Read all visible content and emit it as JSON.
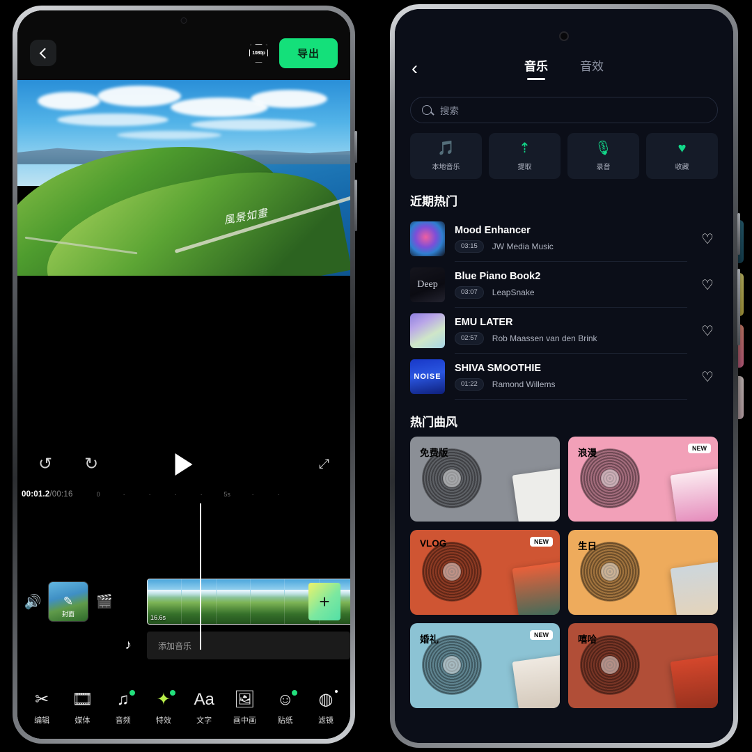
{
  "editor": {
    "back_icon": "chevron-left-icon",
    "quality_label": "1080p",
    "export_label": "导出",
    "preview_watermark": "風景如畫",
    "controls": {
      "undo": "↺",
      "redo": "↻",
      "play": "play-icon",
      "fullscreen": "⤢"
    },
    "timeline": {
      "current_time": "00:01.2",
      "total_time": "/00:16",
      "ruler_ticks": [
        "0",
        "·",
        "·",
        "·",
        "·",
        "5s",
        "·",
        "·"
      ],
      "volume_icon": "speaker-icon",
      "cover_label": "封面",
      "clapper_icon": "clapper-icon",
      "clip_duration": "16.6s",
      "add_clip_label": "+",
      "note_icon": "music-note-icon",
      "add_music_label": "添加音乐"
    },
    "tabbar": [
      {
        "label": "编辑",
        "icon": "scissors-icon",
        "badge": "none"
      },
      {
        "label": "媒体",
        "icon": "film-icon",
        "badge": "none"
      },
      {
        "label": "音频",
        "icon": "music-note-icon",
        "badge": "green"
      },
      {
        "label": "特效",
        "icon": "sparkle-icon",
        "badge": "green"
      },
      {
        "label": "文字",
        "icon": "text-aa-icon",
        "badge": "none"
      },
      {
        "label": "画中画",
        "icon": "pip-icon",
        "badge": "none"
      },
      {
        "label": "贴纸",
        "icon": "sticker-icon",
        "badge": "green"
      },
      {
        "label": "滤镜",
        "icon": "filter-icon",
        "badge": "white"
      }
    ],
    "accent_color": "#14e07a"
  },
  "music": {
    "back_icon": "chevron-left-icon",
    "tabs": [
      {
        "label": "音乐",
        "active": true
      },
      {
        "label": "音效",
        "active": false
      }
    ],
    "search": {
      "placeholder": "搜索",
      "value": "",
      "icon": "search-icon"
    },
    "categories": [
      {
        "label": "本地音乐",
        "icon": "local-music-icon"
      },
      {
        "label": "提取",
        "icon": "extract-icon"
      },
      {
        "label": "录音",
        "icon": "microphone-icon"
      },
      {
        "label": "收藏",
        "icon": "heart-icon"
      }
    ],
    "recent_title": "近期热门",
    "songs": [
      {
        "name": "Mood Enhancer",
        "duration": "03:15",
        "artist": "JW Media Music"
      },
      {
        "name": "Blue Piano Book2",
        "duration": "03:07",
        "artist": "LeapSnake"
      },
      {
        "name": "EMU LATER",
        "duration": "02:57",
        "artist": "Rob Maassen van den Brink"
      },
      {
        "name": "SHIVA SMOOTHIE",
        "duration": "01:22",
        "artist": "Ramond Willems"
      }
    ],
    "genres_title": "热门曲风",
    "new_badge": "NEW",
    "genres": [
      {
        "label": "免费版",
        "new": false,
        "bg": "#8b8f96",
        "text": "#ffffff",
        "sleeve": "#e9e9e7"
      },
      {
        "label": "浪漫",
        "new": true,
        "bg": "#f2a0b8",
        "text": "#ffffff",
        "sleeve": "#f7dce6"
      },
      {
        "label": "VLOG",
        "new": true,
        "bg": "#cf5533",
        "text": "#ffffff",
        "sleeve": "#e6603c"
      },
      {
        "label": "生日",
        "new": false,
        "bg": "#efa martial",
        "text": "#ffffff",
        "sleeve": "#c9d2d8"
      },
      {
        "label": "婚礼",
        "new": true,
        "bg": "#8cc3d4",
        "text": "#ffffff",
        "sleeve": "#eae4dc"
      },
      {
        "label": "嘻哈",
        "new": false,
        "bg": "#b14e37",
        "text": "#ffffff",
        "sleeve": "#c8442c"
      }
    ],
    "accent_color": "#12d98a",
    "bg_color": "#0b0e18"
  }
}
